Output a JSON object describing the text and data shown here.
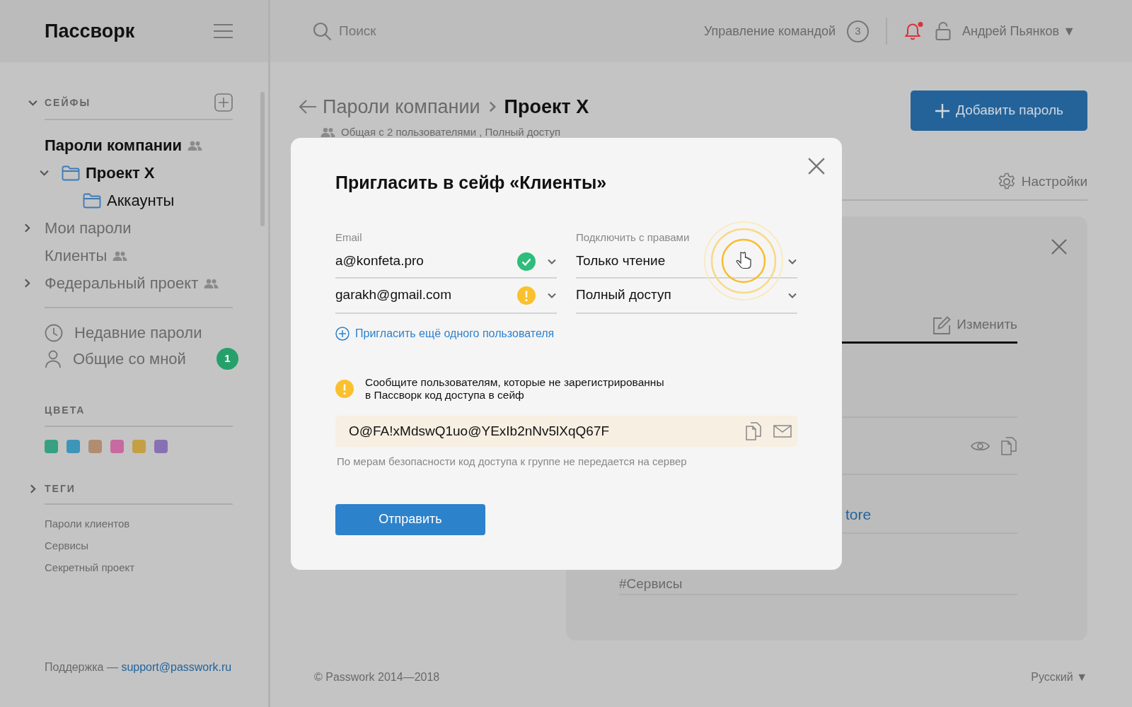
{
  "sidebar": {
    "logo": "Пассворк",
    "safes_header": "СЕЙФЫ",
    "safes": [
      {
        "label": "Пароли компании",
        "bold": true,
        "muted": false,
        "folder": false,
        "shared": true,
        "children": [
          {
            "label": "Проект X",
            "bold": true,
            "muted": false,
            "folder": true,
            "expanded": true,
            "shared": false,
            "children": [
              {
                "label": "Аккаунты",
                "bold": false,
                "muted": false,
                "folder": true,
                "shared": false
              }
            ]
          }
        ]
      },
      {
        "label": "Мои пароли",
        "bold": false,
        "muted": true,
        "folder": false,
        "expanded": false,
        "shared": false
      },
      {
        "label": "Клиенты",
        "bold": false,
        "muted": true,
        "folder": false,
        "shared": true
      },
      {
        "label": "Федеральный проект",
        "bold": false,
        "muted": true,
        "folder": false,
        "expanded": false,
        "shared": true
      }
    ],
    "nav": [
      {
        "label": "Недавние пароли",
        "kind": "recent"
      },
      {
        "label": "Общие со мной",
        "kind": "shared",
        "badge": "1"
      }
    ],
    "colors_header": "ЦВЕТА",
    "colors": [
      {
        "color": "#37a083"
      },
      {
        "color": "#3d95b8"
      },
      {
        "color": "#b08c70"
      },
      {
        "color": "#c76a9f"
      },
      {
        "color": "#c3a043"
      },
      {
        "color": "#8870b5"
      }
    ],
    "tags_header": "ТЕГИ",
    "tags_expanded": false,
    "tags": [
      "Пароли клиентов",
      "Сервисы",
      "Секретный проект"
    ],
    "support": {
      "text": "Поддержка —",
      "email": "support@passwork.ru"
    }
  },
  "topbar": {
    "search_placeholder": "Поиск",
    "team": {
      "label": "Управление командой",
      "count": "3"
    },
    "unread_notifications": true,
    "user": "Андрей Пьянков",
    "user_caret": "▼"
  },
  "page": {
    "breadcrumb": [
      "Пароли компании",
      "Проект X"
    ],
    "subtitle": "Общая с 2 пользователями , Полный доступ",
    "add_button": "Добавить пароль",
    "settings": "Настройки",
    "detail": {
      "edit": "Изменить",
      "link_fragment": "tore",
      "tag_fragment": "#Сервисы"
    }
  },
  "footer": {
    "copyright": "© Passwork 2014—2018",
    "language": "Русский",
    "language_caret": "▼"
  },
  "modal": {
    "title": "Пригласить в сейф «Клиенты»",
    "email_label": "Email",
    "rights_label": "Подключить с правами",
    "invitees": [
      {
        "email": "a@konfeta.pro",
        "verified": true,
        "rights": "Только чтение"
      },
      {
        "email": "garakh@gmail.com",
        "verified": false,
        "rights": "Полный доступ"
      }
    ],
    "add_link": "Пригласить ещё одного пользователя",
    "warning": "Сообщите пользователям, которые не зарегистрированны\nв Пассворк код доступа в сейф",
    "code": "O@FA!xMdswQ1uo@YExIb2nNv5lXqQ67F",
    "note": "По мерам безопасности код доступа к группе не передается на сервер",
    "send_button": "Отправить"
  }
}
